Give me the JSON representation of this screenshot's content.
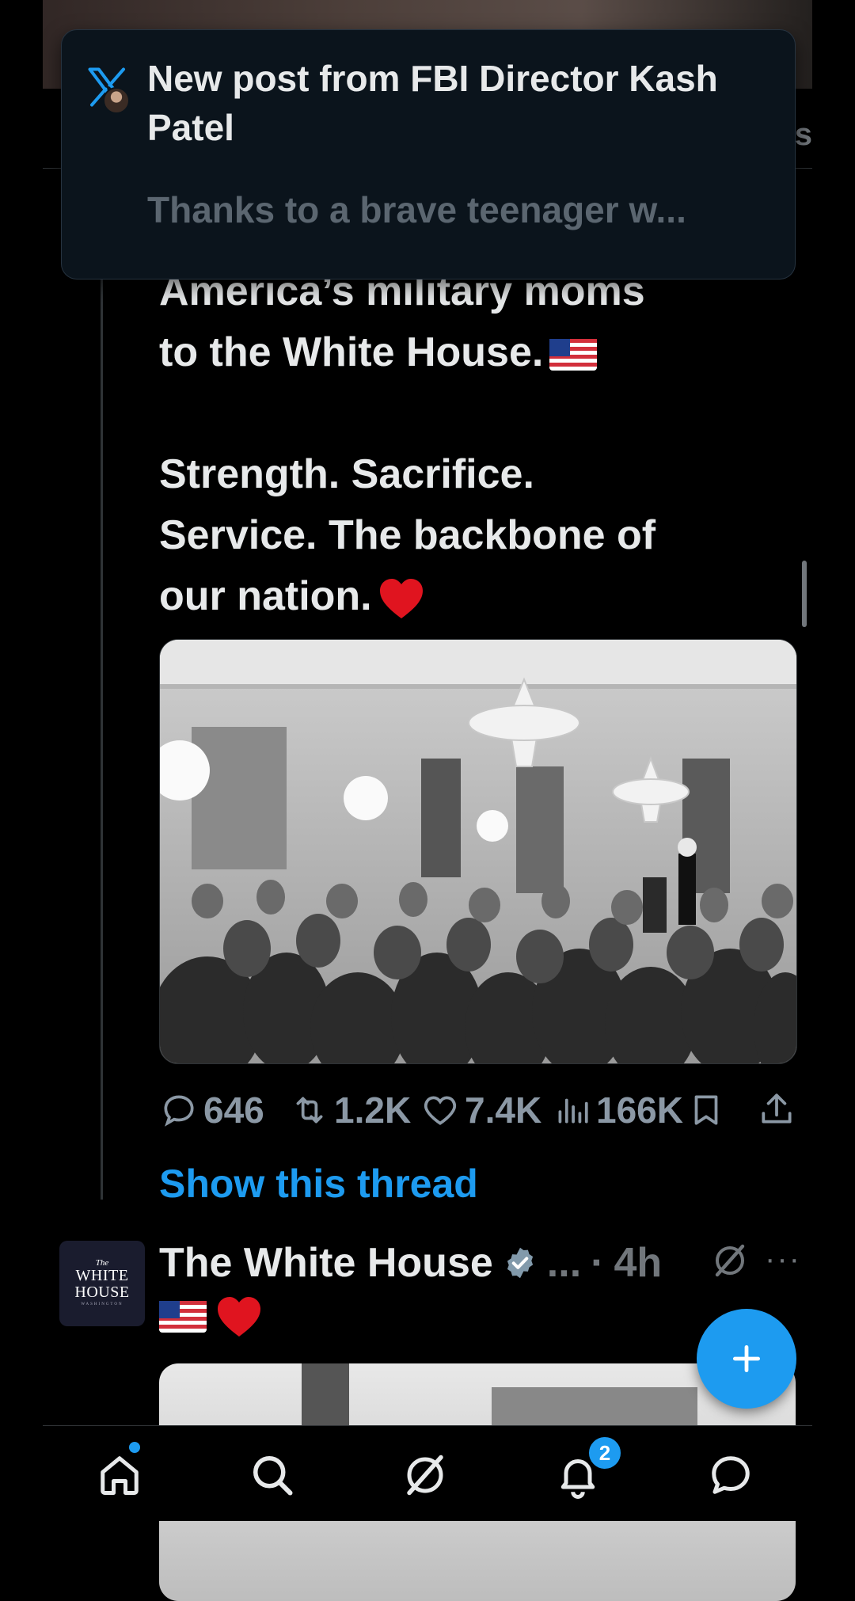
{
  "notification": {
    "title": "New post from FBI Director Kash Patel",
    "body": "Thanks to a brave teenager w...",
    "app_icon": "x-logo-icon"
  },
  "header": {
    "partial_tab": "ts"
  },
  "tweet": {
    "lines": [
      "America’s military moms",
      "to the White House.",
      "",
      "Strength. Sacrifice.",
      "Service. The backbone of",
      "our nation."
    ],
    "emoji_flag": "flag-us-icon",
    "emoji_heart": "red-heart-icon",
    "stats": {
      "replies": "646",
      "reposts": "1.2K",
      "likes": "7.4K",
      "views": "166K"
    },
    "show_thread": "Show this thread"
  },
  "next_tweet": {
    "author": "The White House",
    "truncation": "...",
    "separator": "·",
    "time": "4h",
    "avatar": {
      "line1": "The",
      "line2": "WHITE",
      "line3": "HOUSE",
      "line4": "WASHINGTON"
    }
  },
  "nav": {
    "items": [
      "home-icon",
      "search-icon",
      "grok-icon",
      "notifications-icon",
      "messages-icon"
    ],
    "notification_badge": "2"
  },
  "colors": {
    "accent": "#1d9bf0",
    "background": "#000000",
    "muted": "#71767b"
  }
}
